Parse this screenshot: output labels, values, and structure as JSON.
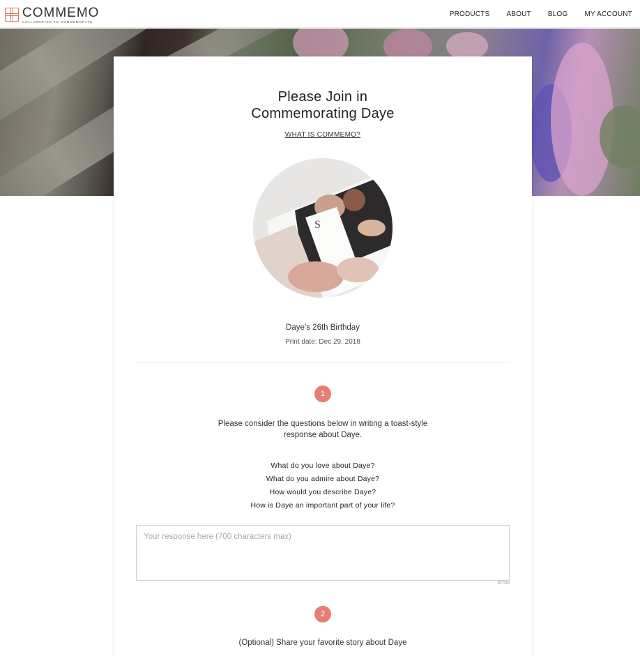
{
  "header": {
    "logo_name": "COMMEMO",
    "logo_tagline": "COLLABORATE TO COMMEMORATE",
    "nav": [
      "PRODUCTS",
      "ABOUT",
      "BLOG",
      "MY ACCOUNT"
    ]
  },
  "card": {
    "title_line1": "Please Join in",
    "title_line2": "Commemorating Daye",
    "what_link": "WHAT IS COMMEMO?",
    "occasion": "Daye’s 26th Birthday",
    "print_date": "Print date: Dec 29, 2018"
  },
  "step1": {
    "number": "1",
    "intro": "Please consider the questions below in writing a toast-style response about Daye.",
    "questions": [
      "What do you love about Daye?",
      "What do you admire about Daye?",
      "How would you describe Daye?",
      "How is Daye an important part of your life?"
    ],
    "response_placeholder": "Your response here (700 characters max)",
    "response_value": "",
    "counter": "0/700"
  },
  "step2": {
    "number": "2",
    "prompt": "(Optional) Share your favorite story about Daye"
  },
  "colors": {
    "accent": "#e67e76",
    "logo": "#c9825e"
  }
}
